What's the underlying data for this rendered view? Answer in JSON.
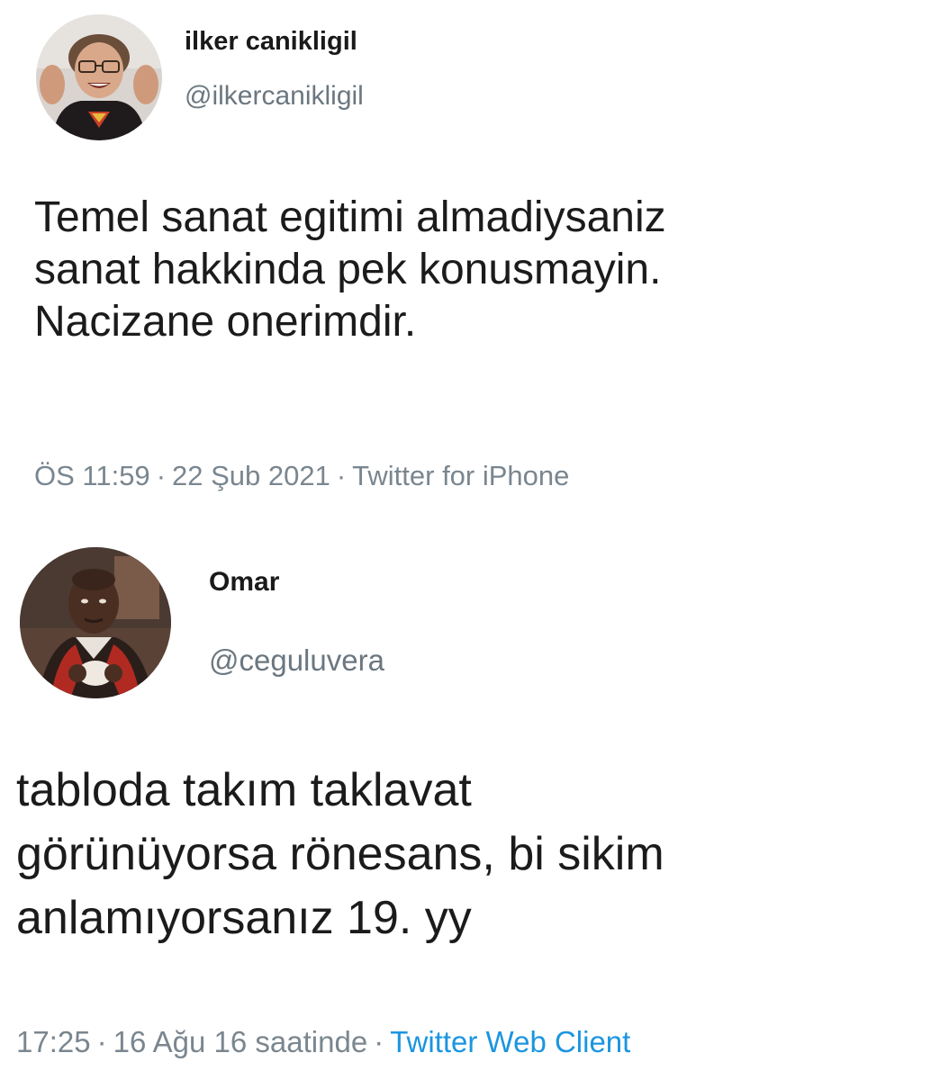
{
  "tweets": [
    {
      "author": {
        "name": "ilker canikligil",
        "handle": "@ilkercanikligil"
      },
      "text_lines": [
        "Temel sanat egitimi almadiysaniz",
        "sanat hakkinda pek konusmayin.",
        "Nacizane onerimdir."
      ],
      "time": "ÖS 11:59",
      "date": "22 Şub 2021",
      "source": "Twitter for iPhone",
      "separator": "·",
      "source_color": "#7a868f"
    },
    {
      "author": {
        "name": "Omar",
        "handle": "@ceguluvera"
      },
      "text_lines": [
        "tabloda takım taklavat",
        "görünüyorsa rönesans, bi sikim",
        "anlamıyorsanız 19. yy"
      ],
      "time": "17:25",
      "date": "16 Ağu 16 saatinde",
      "source": "Twitter Web Client",
      "separator": "·",
      "source_color": "#1b95e0"
    }
  ]
}
